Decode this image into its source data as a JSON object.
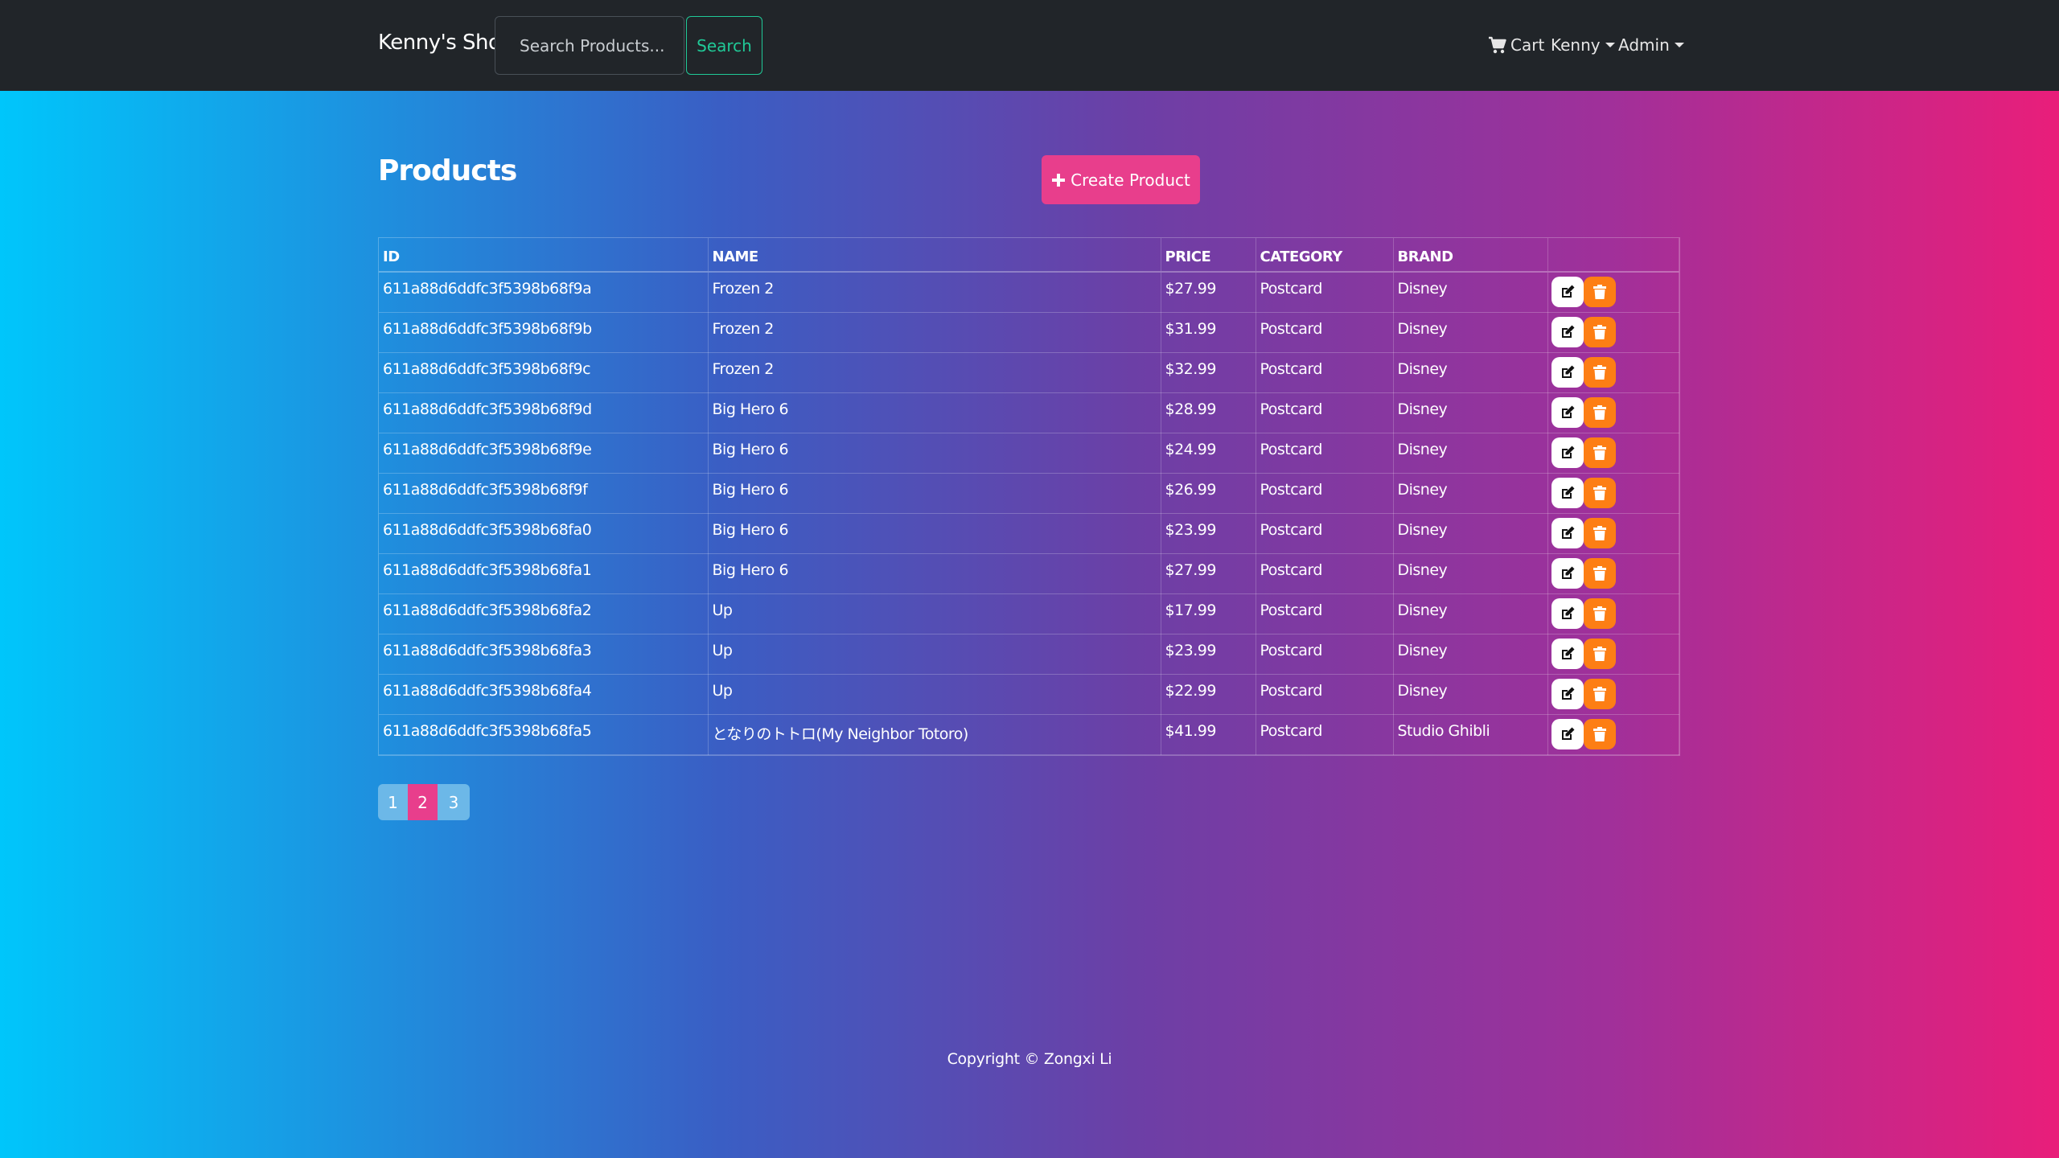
{
  "navbar": {
    "brand": "Kenny's Shop",
    "search_placeholder": "Search Products...",
    "search_button": "Search",
    "cart_label": "Cart",
    "user_menu": "Kenny",
    "admin_menu": "Admin"
  },
  "page": {
    "title": "Products",
    "create_button": "Create Product"
  },
  "table": {
    "headers": [
      "ID",
      "NAME",
      "PRICE",
      "CATEGORY",
      "BRAND"
    ],
    "rows": [
      {
        "id": "611a88d6ddfc3f5398b68f9a",
        "name": "Frozen 2",
        "price": "$27.99",
        "category": "Postcard",
        "brand": "Disney"
      },
      {
        "id": "611a88d6ddfc3f5398b68f9b",
        "name": "Frozen 2",
        "price": "$31.99",
        "category": "Postcard",
        "brand": "Disney"
      },
      {
        "id": "611a88d6ddfc3f5398b68f9c",
        "name": "Frozen 2",
        "price": "$32.99",
        "category": "Postcard",
        "brand": "Disney"
      },
      {
        "id": "611a88d6ddfc3f5398b68f9d",
        "name": "Big Hero 6",
        "price": "$28.99",
        "category": "Postcard",
        "brand": "Disney"
      },
      {
        "id": "611a88d6ddfc3f5398b68f9e",
        "name": "Big Hero 6",
        "price": "$24.99",
        "category": "Postcard",
        "brand": "Disney"
      },
      {
        "id": "611a88d6ddfc3f5398b68f9f",
        "name": "Big Hero 6",
        "price": "$26.99",
        "category": "Postcard",
        "brand": "Disney"
      },
      {
        "id": "611a88d6ddfc3f5398b68fa0",
        "name": "Big Hero 6",
        "price": "$23.99",
        "category": "Postcard",
        "brand": "Disney"
      },
      {
        "id": "611a88d6ddfc3f5398b68fa1",
        "name": "Big Hero 6",
        "price": "$27.99",
        "category": "Postcard",
        "brand": "Disney"
      },
      {
        "id": "611a88d6ddfc3f5398b68fa2",
        "name": "Up",
        "price": "$17.99",
        "category": "Postcard",
        "brand": "Disney"
      },
      {
        "id": "611a88d6ddfc3f5398b68fa3",
        "name": "Up",
        "price": "$23.99",
        "category": "Postcard",
        "brand": "Disney"
      },
      {
        "id": "611a88d6ddfc3f5398b68fa4",
        "name": "Up",
        "price": "$22.99",
        "category": "Postcard",
        "brand": "Disney"
      },
      {
        "id": "611a88d6ddfc3f5398b68fa5",
        "name": "となりのトトロ(My Neighbor Totoro)",
        "price": "$41.99",
        "category": "Postcard",
        "brand": "Studio Ghibli"
      }
    ]
  },
  "pagination": {
    "pages": [
      "1",
      "2",
      "3"
    ],
    "active": "2"
  },
  "footer": {
    "copyright": "Copyright © Zongxi Li"
  },
  "colors": {
    "navbar_bg": "#212529",
    "search_accent": "#20c997",
    "primary_pink": "#e83e8c",
    "delete_orange": "#fd7e14",
    "pagination_inactive": "#6cb8e8"
  },
  "icons": {
    "cart": "cart-icon",
    "plus": "plus-icon",
    "edit": "edit-icon",
    "delete": "trash-icon"
  }
}
